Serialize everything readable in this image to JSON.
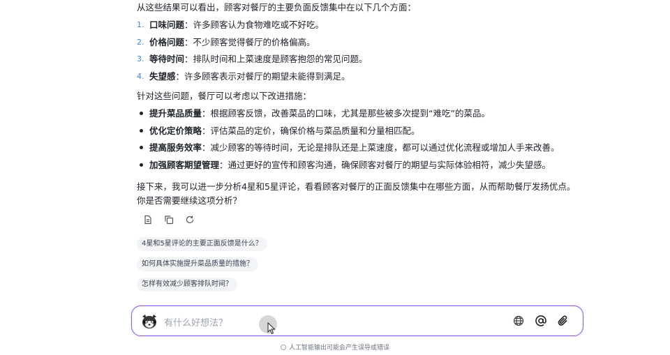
{
  "intro": "从这些结果可以看出，顾客对餐厅的主要负面反馈集中在以下几个方面：",
  "issues": [
    {
      "num": "1.",
      "title": "口味问题",
      "text": "：许多顾客认为食物难吃或不好吃。"
    },
    {
      "num": "2.",
      "title": "价格问题",
      "text": "：不少顾客觉得餐厅的价格偏高。"
    },
    {
      "num": "3.",
      "title": "等待时间",
      "text": "：排队时间和上菜速度是顾客抱怨的常见问题。"
    },
    {
      "num": "4.",
      "title": "失望感",
      "text": "：许多顾客表示对餐厅的期望未能得到满足。"
    }
  ],
  "measures_intro": "针对这些问题，餐厅可以考虑以下改进措施：",
  "measures": [
    {
      "title": "提升菜品质量",
      "text": "：根据顾客反馈，改善菜品的口味，尤其是那些被多次提到“难吃”的菜品。"
    },
    {
      "title": "优化定价策略",
      "text": "：评估菜品的定价，确保价格与菜品质量和分量相匹配。"
    },
    {
      "title": "提高服务效率",
      "text": "：减少顾客的等待时间，无论是排队还是上菜速度，都可以通过优化流程或增加人手来改善。"
    },
    {
      "title": "加强顾客期望管理",
      "text": "：通过更好的宣传和顾客沟通，确保顾客对餐厅的期望与实际体验相符，减少失望感。"
    }
  ],
  "closing": "接下来，我可以进一步分析4星和5星评论，看看顾客对餐厅的正面反馈集中在哪些方面，从而帮助餐厅发扬优点。你是否需要继续这项分析？",
  "actions": {
    "copy_doc": "document-icon",
    "copy": "copy-icon",
    "regenerate": "refresh-icon"
  },
  "suggestions": [
    "4星和5星评论的主要正面反馈是什么？",
    "如何具体实施提升菜品质量的措施？",
    "怎样有效减少顾客排队时间？"
  ],
  "input": {
    "placeholder": "有什么好想法？"
  },
  "disclaimer": "人工智能输出可能会产生误导或错误",
  "colors": {
    "accent": "#8b5cf6",
    "list_number": "#3b82f6"
  }
}
